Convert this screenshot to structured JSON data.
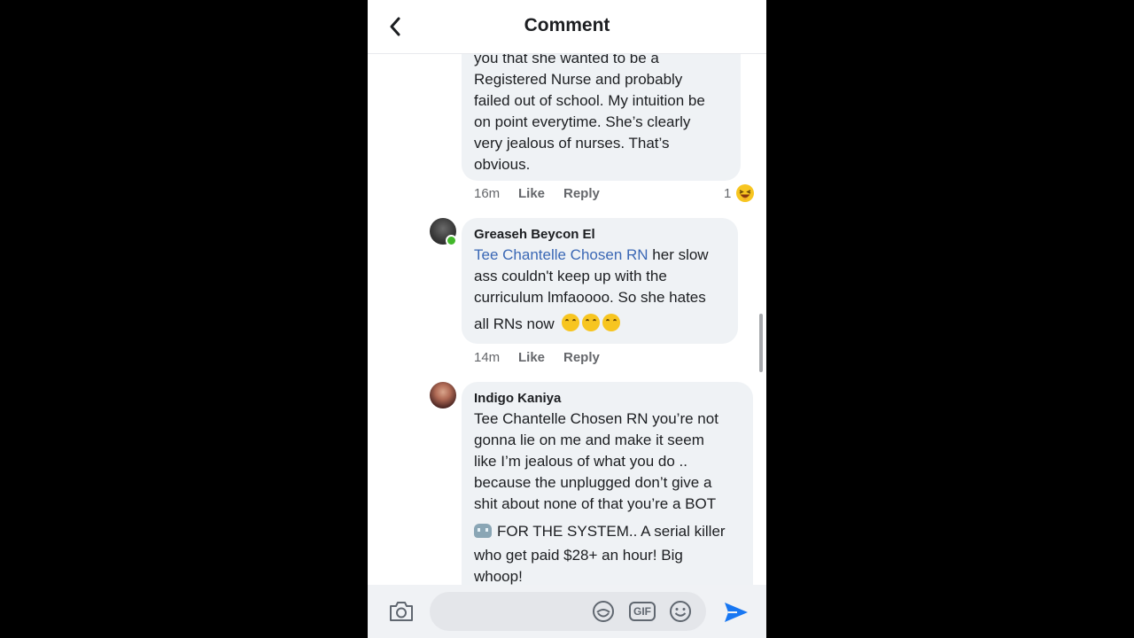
{
  "header": {
    "title": "Comment"
  },
  "comments": [
    {
      "lines": [
        "you that she wanted to be a",
        "Registered Nurse and probably",
        "failed out of school. My intuition be",
        "on point everytime. She’s clearly",
        "very jealous of nurses. That’s",
        "obvious."
      ],
      "time": "16m",
      "like": "Like",
      "reply": "Reply",
      "reaction_count": "1",
      "reaction_icon": "haha-reaction-icon"
    },
    {
      "author": "Greaseh Beycon El",
      "mention": "Tee Chantelle Chosen RN",
      "lines": [
        " her slow",
        "ass couldn't keep up with the",
        "curriculum lmfaoooo. So she hates",
        "all RNs now"
      ],
      "emoji": "rolling-on-floor-laughing-emoji",
      "time": "14m",
      "like": "Like",
      "reply": "Reply"
    },
    {
      "author": "Indigo Kaniya",
      "lines": [
        "Tee Chantelle Chosen RN you’re not",
        "gonna lie on me and make it seem",
        "like I’m jealous of what you do ..",
        "because the unplugged don’t give a",
        "shit about none of that you’re a BOT",
        "FOR THE SYSTEM.. A serial killer",
        "who get paid $28+ an hour! Big",
        "whoop!"
      ],
      "emoji": "robot-face-emoji"
    }
  ],
  "composer": {
    "placeholder": ""
  },
  "icons": {
    "back": "back-arrow-icon",
    "camera": "camera-icon",
    "sticker": "sticker-icon",
    "gif": "GIF",
    "emoji": "emoji-icon",
    "send": "send-icon"
  },
  "colors": {
    "mention": "#3b68b5",
    "send": "#1877f2",
    "bubble": "#eff2f5"
  }
}
